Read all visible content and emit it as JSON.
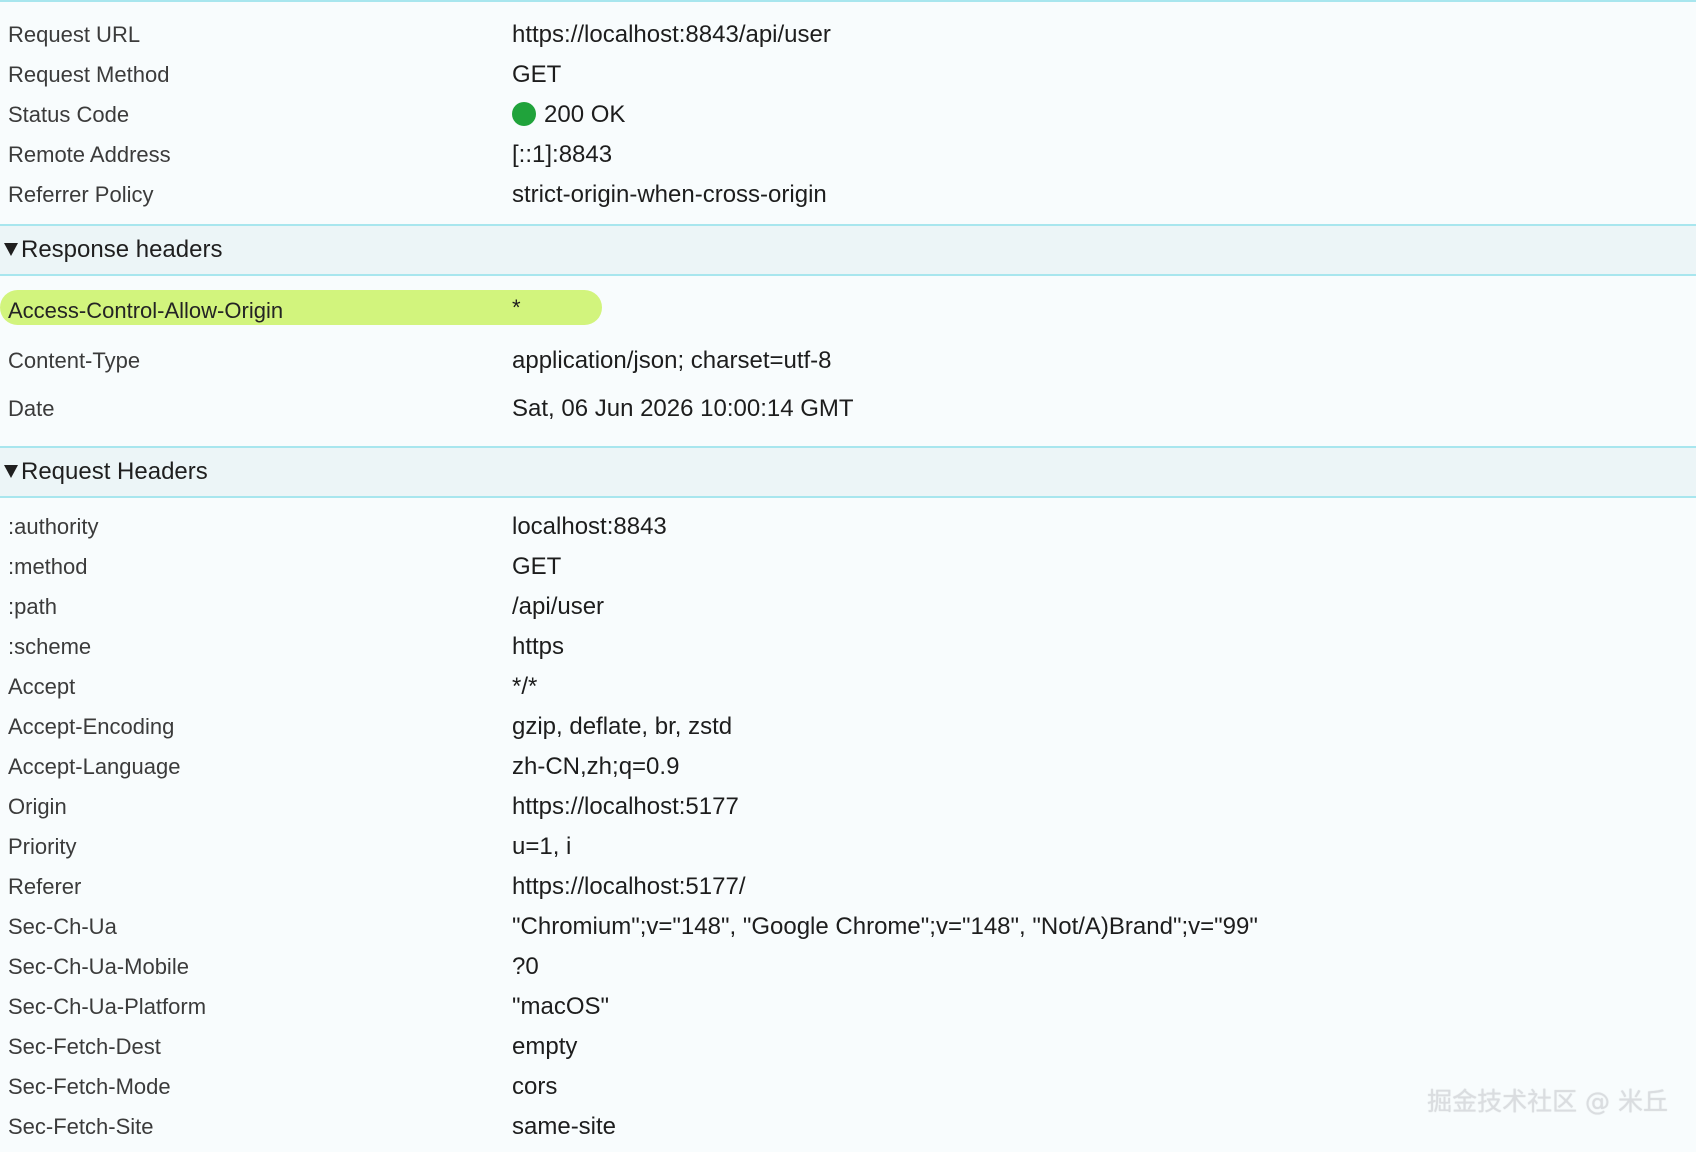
{
  "general": [
    {
      "key": "Request URL",
      "value": "https://localhost:8843/api/user"
    },
    {
      "key": "Request Method",
      "value": "GET"
    },
    {
      "key": "Status Code",
      "value": "200 OK"
    },
    {
      "key": "Remote Address",
      "value": "[::1]:8843"
    },
    {
      "key": "Referrer Policy",
      "value": "strict-origin-when-cross-origin"
    }
  ],
  "status_color": "#20a33b",
  "response_headers": {
    "title": "Response headers",
    "items": [
      {
        "key": "Access-Control-Allow-Origin",
        "value": "*"
      },
      {
        "key": "Content-Type",
        "value": "application/json; charset=utf-8"
      },
      {
        "key": "Date",
        "value": "Sat, 06 Jun 2026 10:00:14 GMT"
      }
    ],
    "highlight_color": "#d2f47d"
  },
  "request_headers": {
    "title": "Request Headers",
    "items": [
      {
        "key": ":authority",
        "value": "localhost:8843"
      },
      {
        "key": ":method",
        "value": "GET"
      },
      {
        "key": ":path",
        "value": "/api/user"
      },
      {
        "key": ":scheme",
        "value": "https"
      },
      {
        "key": "Accept",
        "value": "*/*"
      },
      {
        "key": "Accept-Encoding",
        "value": "gzip, deflate, br, zstd"
      },
      {
        "key": "Accept-Language",
        "value": "zh-CN,zh;q=0.9"
      },
      {
        "key": "Origin",
        "value": "https://localhost:5177"
      },
      {
        "key": "Priority",
        "value": "u=1, i"
      },
      {
        "key": "Referer",
        "value": "https://localhost:5177/"
      },
      {
        "key": "Sec-Ch-Ua",
        "value": "\"Chromium\";v=\"148\", \"Google Chrome\";v=\"148\", \"Not/A)Brand\";v=\"99\""
      },
      {
        "key": "Sec-Ch-Ua-Mobile",
        "value": "?0"
      },
      {
        "key": "Sec-Ch-Ua-Platform",
        "value": "\"macOS\""
      },
      {
        "key": "Sec-Fetch-Dest",
        "value": "empty"
      },
      {
        "key": "Sec-Fetch-Mode",
        "value": "cors"
      },
      {
        "key": "Sec-Fetch-Site",
        "value": "same-site"
      }
    ]
  },
  "watermark": "掘金技术社区 @ 米丘",
  "icons": {
    "status": "status-dot-icon",
    "collapse": "triangle-down-icon"
  }
}
